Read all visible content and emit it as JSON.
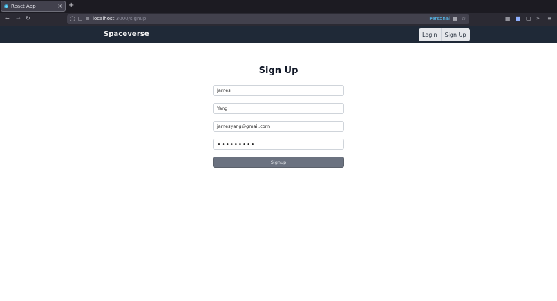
{
  "browser": {
    "tab_title": "React App",
    "tab_close": "×",
    "new_tab": "+",
    "url_host": "localhost",
    "url_path": ":3000/signup",
    "container_label": "Personal",
    "accent_color": "#5ac8ff"
  },
  "app": {
    "brand": "Spaceverse",
    "nav": {
      "login_label": "Login",
      "signup_label": "Sign Up"
    },
    "header_bg": "#1f2937"
  },
  "form": {
    "title": "Sign Up",
    "first_name_value": "James",
    "last_name_value": "Yang",
    "email_value": "jamesyang@gmail.com",
    "password_masked": "•••••••••",
    "submit_label": "Signup",
    "submit_bg": "#6b7280"
  }
}
